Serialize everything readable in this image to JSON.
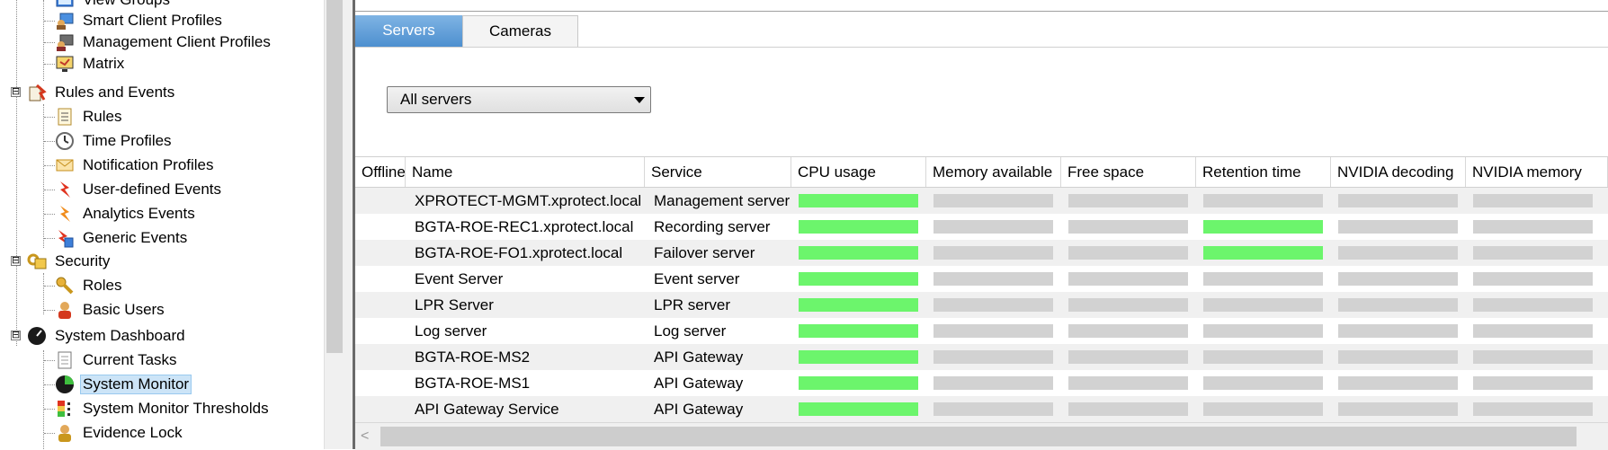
{
  "tree": {
    "items": [
      {
        "label": "View Groups",
        "icon": "view-groups-icon"
      },
      {
        "label": "Smart Client Profiles",
        "icon": "smart-client-profiles-icon"
      },
      {
        "label": "Management Client Profiles",
        "icon": "management-client-profiles-icon"
      },
      {
        "label": "Matrix",
        "icon": "matrix-icon"
      },
      {
        "label": "Rules and Events",
        "icon": "rules-and-events-icon"
      },
      {
        "label": "Rules",
        "icon": "rules-icon"
      },
      {
        "label": "Time Profiles",
        "icon": "time-profiles-icon"
      },
      {
        "label": "Notification Profiles",
        "icon": "notification-profiles-icon"
      },
      {
        "label": "User-defined Events",
        "icon": "user-defined-events-icon"
      },
      {
        "label": "Analytics Events",
        "icon": "analytics-events-icon"
      },
      {
        "label": "Generic Events",
        "icon": "generic-events-icon"
      },
      {
        "label": "Security",
        "icon": "security-icon"
      },
      {
        "label": "Roles",
        "icon": "roles-icon"
      },
      {
        "label": "Basic Users",
        "icon": "basic-users-icon"
      },
      {
        "label": "System Dashboard",
        "icon": "system-dashboard-icon"
      },
      {
        "label": "Current Tasks",
        "icon": "current-tasks-icon"
      },
      {
        "label": "System Monitor",
        "icon": "system-monitor-icon"
      },
      {
        "label": "System Monitor Thresholds",
        "icon": "system-monitor-thresholds-icon"
      },
      {
        "label": "Evidence Lock",
        "icon": "evidence-lock-icon"
      }
    ],
    "expander_symbol": "⊟"
  },
  "tabs": [
    {
      "label": "Servers",
      "active": true
    },
    {
      "label": "Cameras",
      "active": false
    }
  ],
  "filter": {
    "selected": "All servers"
  },
  "table": {
    "columns": [
      "Offline",
      "Name",
      "Service",
      "CPU usage",
      "Memory available",
      "Free space",
      "Retention time",
      "NVIDIA decoding",
      "NVIDIA memory"
    ],
    "rows": [
      {
        "name": "XPROTECT-MGMT.xprotect.local",
        "service": "Management server",
        "cpu": "green",
        "memory": "gray",
        "free": "gray",
        "retention": "gray",
        "nv_dec": "gray",
        "nv_mem": "gray"
      },
      {
        "name": "BGTA-ROE-REC1.xprotect.local",
        "service": "Recording server",
        "cpu": "green",
        "memory": "gray",
        "free": "gray",
        "retention": "green",
        "nv_dec": "gray",
        "nv_mem": "gray"
      },
      {
        "name": "BGTA-ROE-FO1.xprotect.local",
        "service": "Failover server",
        "cpu": "green",
        "memory": "gray",
        "free": "gray",
        "retention": "green",
        "nv_dec": "gray",
        "nv_mem": "gray"
      },
      {
        "name": "Event Server",
        "service": "Event server",
        "cpu": "green",
        "memory": "gray",
        "free": "gray",
        "retention": "gray",
        "nv_dec": "gray",
        "nv_mem": "gray"
      },
      {
        "name": "LPR Server",
        "service": "LPR server",
        "cpu": "green",
        "memory": "gray",
        "free": "gray",
        "retention": "gray",
        "nv_dec": "gray",
        "nv_mem": "gray"
      },
      {
        "name": "Log server",
        "service": "Log server",
        "cpu": "green",
        "memory": "gray",
        "free": "gray",
        "retention": "gray",
        "nv_dec": "gray",
        "nv_mem": "gray"
      },
      {
        "name": "BGTA-ROE-MS2",
        "service": "API Gateway",
        "cpu": "green",
        "memory": "gray",
        "free": "gray",
        "retention": "gray",
        "nv_dec": "gray",
        "nv_mem": "gray"
      },
      {
        "name": "BGTA-ROE-MS1",
        "service": "API Gateway",
        "cpu": "green",
        "memory": "gray",
        "free": "gray",
        "retention": "gray",
        "nv_dec": "gray",
        "nv_mem": "gray"
      },
      {
        "name": "API Gateway Service",
        "service": "API Gateway",
        "cpu": "green",
        "memory": "gray",
        "free": "gray",
        "retention": "gray",
        "nv_dec": "gray",
        "nv_mem": "gray"
      }
    ]
  },
  "colors": {
    "ok": "#6cf56c",
    "na": "#d2d2d2",
    "tab_active": "#5b9bd5",
    "selection": "#cce4f7"
  },
  "scroll": {
    "left_arrow": "<"
  }
}
